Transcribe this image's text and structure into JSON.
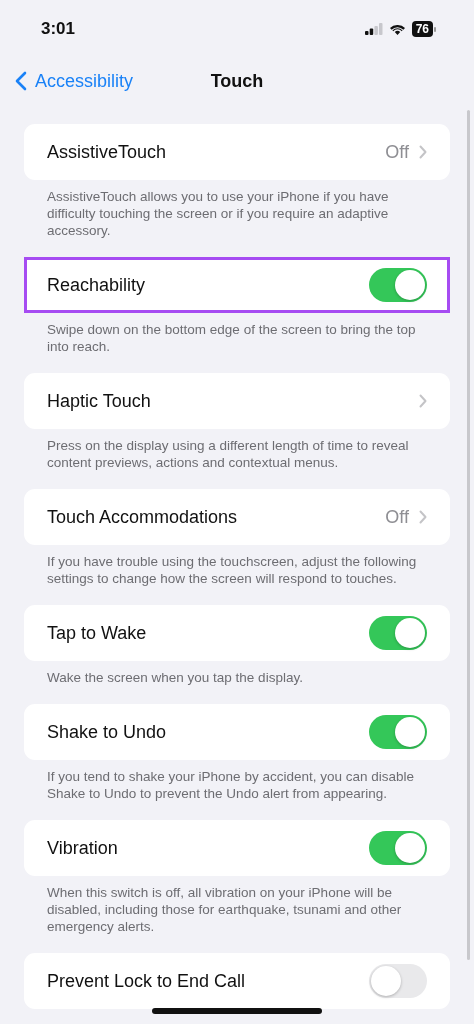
{
  "status_bar": {
    "time": "3:01",
    "battery": "76"
  },
  "nav": {
    "back": "Accessibility",
    "title": "Touch"
  },
  "sections": [
    {
      "kind": "link",
      "label": "AssistiveTouch",
      "value": "Off",
      "highlighted": false,
      "footer": "AssistiveTouch allows you to use your iPhone if you have difficulty touching the screen or if you require an adaptive accessory."
    },
    {
      "kind": "switch",
      "label": "Reachability",
      "on": true,
      "highlighted": true,
      "footer": "Swipe down on the bottom edge of the screen to bring the top into reach."
    },
    {
      "kind": "link",
      "label": "Haptic Touch",
      "highlighted": false,
      "footer": "Press on the display using a different length of time to reveal content previews, actions and contextual menus."
    },
    {
      "kind": "link",
      "label": "Touch Accommodations",
      "value": "Off",
      "highlighted": false,
      "footer": "If you have trouble using the touchscreen, adjust the following settings to change how the screen will respond to touches."
    },
    {
      "kind": "switch",
      "label": "Tap to Wake",
      "on": true,
      "highlighted": false,
      "footer": "Wake the screen when you tap the display."
    },
    {
      "kind": "switch",
      "label": "Shake to Undo",
      "on": true,
      "highlighted": false,
      "footer": "If you tend to shake your iPhone by accident, you can disable Shake to Undo to prevent the Undo alert from appearing."
    },
    {
      "kind": "switch",
      "label": "Vibration",
      "on": true,
      "highlighted": false,
      "footer": "When this switch is off, all vibration on your iPhone will be disabled, including those for earthquake, tsunami and other emergency alerts."
    },
    {
      "kind": "switch",
      "label": "Prevent Lock to End Call",
      "on": false,
      "highlighted": false
    }
  ]
}
